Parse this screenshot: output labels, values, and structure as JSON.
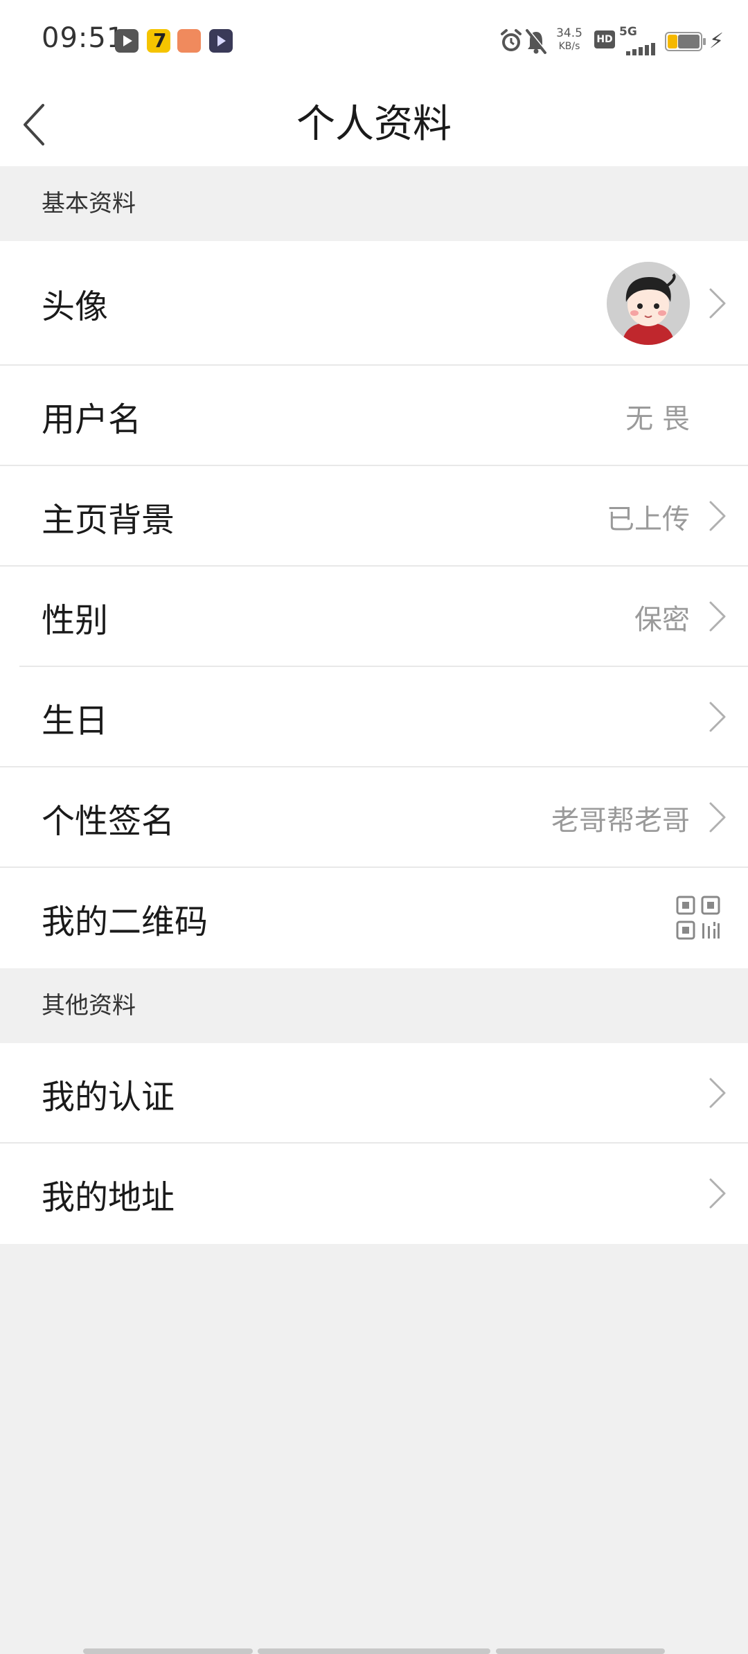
{
  "status_bar": {
    "time": "09:51",
    "net_speed_value": "34.5",
    "net_speed_unit": "KB/s",
    "hd_label": "HD",
    "network_label": "5G",
    "battery_percent": 35
  },
  "header": {
    "title": "个人资料"
  },
  "sections": {
    "basic": {
      "title": "基本资料",
      "avatar_label": "头像",
      "username_label": "用户名",
      "username_value": "无 畏",
      "background_label": "主页背景",
      "background_value": "已上传",
      "gender_label": "性别",
      "gender_value": "保密",
      "birthday_label": "生日",
      "signature_label": "个性签名",
      "signature_value": "老哥帮老哥",
      "qrcode_label": "我的二维码"
    },
    "other": {
      "title": "其他资料",
      "verification_label": "我的认证",
      "address_label": "我的地址"
    }
  },
  "colors": {
    "background": "#f0f0f0",
    "row": "#ffffff",
    "text_primary": "#1a1a1a",
    "text_secondary": "#9a9a9a",
    "chevron": "#b0b0b0"
  },
  "icons": {
    "back": "chevron-left-icon",
    "row_arrow": "chevron-right-icon",
    "qrcode": "qrcode-icon",
    "avatar": "avatar-image"
  }
}
